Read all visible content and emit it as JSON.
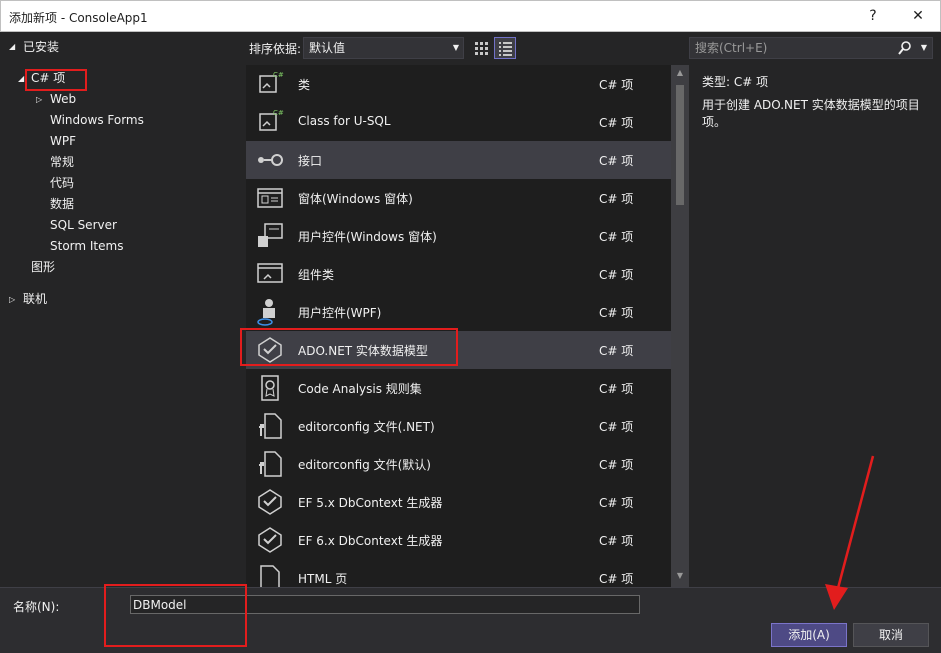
{
  "window": {
    "title": "添加新项 - ConsoleApp1",
    "help": "?",
    "close": "✕"
  },
  "tree": {
    "installed": "已安装",
    "csharp": "C# 项",
    "web": "Web",
    "winforms": "Windows Forms",
    "wpf": "WPF",
    "general": "常规",
    "code": "代码",
    "data": "数据",
    "sqlserver": "SQL Server",
    "storm": "Storm Items",
    "graphics": "图形",
    "online": "联机"
  },
  "toolbar": {
    "sort_label": "排序依据:",
    "sort_value": "默认值",
    "search_placeholder": "搜索(Ctrl+E)"
  },
  "items": [
    {
      "name": "类",
      "lang": "C# 项",
      "icon": "class-icon"
    },
    {
      "name": "Class for U-SQL",
      "lang": "C# 项",
      "icon": "class-icon"
    },
    {
      "name": "接口",
      "lang": "C# 项",
      "icon": "interface-icon"
    },
    {
      "name": "窗体(Windows 窗体)",
      "lang": "C# 项",
      "icon": "form-icon"
    },
    {
      "name": "用户控件(Windows 窗体)",
      "lang": "C# 项",
      "icon": "usercontrol-icon"
    },
    {
      "name": "组件类",
      "lang": "C# 项",
      "icon": "component-icon"
    },
    {
      "name": "用户控件(WPF)",
      "lang": "C# 项",
      "icon": "wpf-usercontrol-icon"
    },
    {
      "name": "ADO.NET 实体数据模型",
      "lang": "C# 项",
      "icon": "entity-model-icon"
    },
    {
      "name": "Code Analysis 规则集",
      "lang": "C# 项",
      "icon": "ruleset-icon"
    },
    {
      "name": "editorconfig 文件(.NET)",
      "lang": "C# 项",
      "icon": "config-file-icon"
    },
    {
      "name": "editorconfig 文件(默认)",
      "lang": "C# 项",
      "icon": "config-file-icon"
    },
    {
      "name": "EF 5.x DbContext 生成器",
      "lang": "C# 项",
      "icon": "entity-model-icon"
    },
    {
      "name": "EF 6.x DbContext 生成器",
      "lang": "C# 项",
      "icon": "entity-model-icon"
    },
    {
      "name": "HTML 页",
      "lang": "C# 项",
      "icon": "html-file-icon"
    }
  ],
  "detail": {
    "type_label": "类型:",
    "type_value": "C# 项",
    "description": "用于创建 ADO.NET 实体数据模型的项目项。"
  },
  "bottom": {
    "name_label": "名称(N):",
    "name_value": "DBModel",
    "add_button": "添加(A)",
    "cancel_button": "取消"
  },
  "colors": {
    "accent": "#7b74c9",
    "annotation_red": "#e21d1d"
  }
}
